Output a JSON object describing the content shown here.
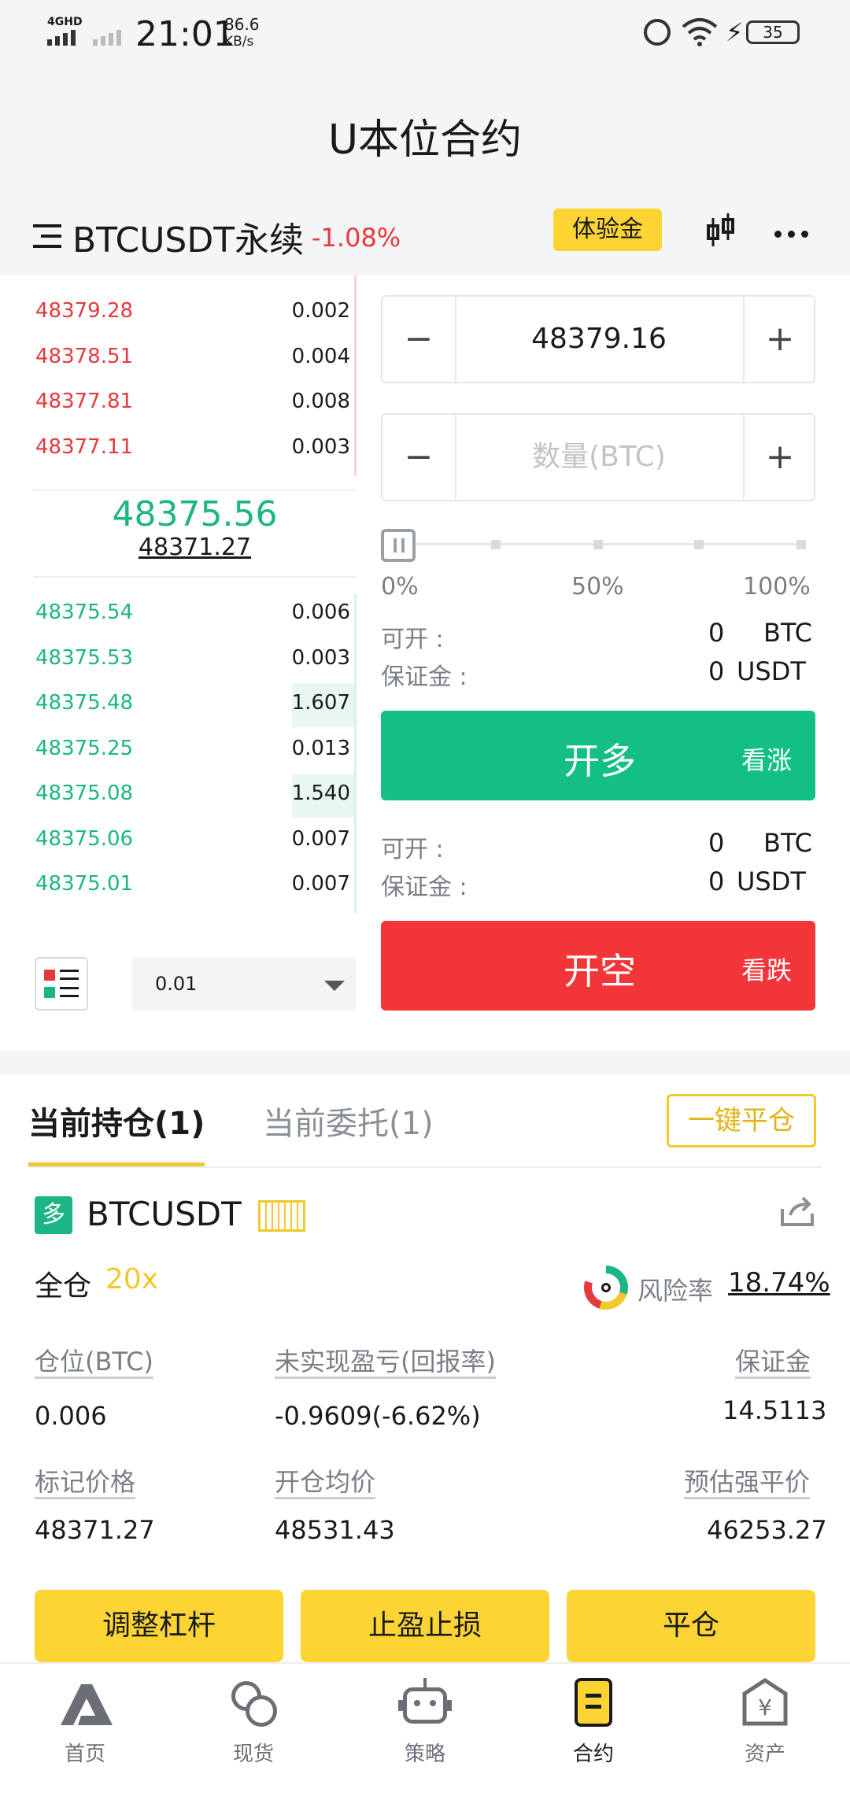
{
  "status": {
    "network": "4GHD",
    "time": "21:01",
    "speed_value": "86.6",
    "speed_unit": "KB/s",
    "battery": "35"
  },
  "page_title": "U本位合约",
  "instrument": {
    "name": "BTCUSDT永续",
    "change": "-1.08%",
    "badge": "体验金"
  },
  "orderbook": {
    "asks": [
      {
        "price": "48379.28",
        "qty": "0.002"
      },
      {
        "price": "48378.51",
        "qty": "0.004"
      },
      {
        "price": "48377.81",
        "qty": "0.008"
      },
      {
        "price": "48377.11",
        "qty": "0.003"
      }
    ],
    "last_price": "48375.56",
    "mark_price": "48371.27",
    "bids": [
      {
        "price": "48375.54",
        "qty": "0.006"
      },
      {
        "price": "48375.53",
        "qty": "0.003"
      },
      {
        "price": "48375.48",
        "qty": "1.607"
      },
      {
        "price": "48375.25",
        "qty": "0.013"
      },
      {
        "price": "48375.08",
        "qty": "1.540"
      },
      {
        "price": "48375.06",
        "qty": "0.007"
      },
      {
        "price": "48375.01",
        "qty": "0.007"
      }
    ],
    "depth_value": "0.01"
  },
  "order": {
    "price_value": "48379.16",
    "qty_placeholder": "数量(BTC)",
    "minus": "−",
    "plus": "+",
    "pct_0": "0%",
    "pct_50": "50%",
    "pct_100": "100%",
    "open_label": "可开 :",
    "margin_label": "保证金 :",
    "long_open_value": "0",
    "long_open_unit": "BTC",
    "long_margin_value": "0",
    "long_margin_unit": "USDT",
    "long_button": "开多",
    "long_sub": "看涨",
    "short_open_value": "0",
    "short_open_unit": "BTC",
    "short_margin_value": "0",
    "short_margin_unit": "USDT",
    "short_button": "开空",
    "short_sub": "看跌",
    "long_color": "#14bf85",
    "short_color": "#f23538"
  },
  "positions": {
    "tab_current": "当前持仓(1)",
    "tab_orders": "当前委托(1)",
    "close_all": "一键平仓",
    "side_tag": "多",
    "symbol": "BTCUSDT",
    "mode": "全仓",
    "leverage": "20x",
    "risk_label": "风险率",
    "risk_value": "18.74%",
    "f_size_label": "仓位(BTC)",
    "f_size_value": "0.006",
    "f_pnl_label": "未实现盈亏(回报率)",
    "f_pnl_value": "-0.9609(-6.62%)",
    "f_margin_label": "保证金",
    "f_margin_value": "14.5113",
    "f_mark_label": "标记价格",
    "f_mark_value": "48371.27",
    "f_entry_label": "开仓均价",
    "f_entry_value": "48531.43",
    "f_liq_label": "预估强平价",
    "f_liq_value": "46253.27",
    "btn_leverage": "调整杠杆",
    "btn_tpsl": "止盈止损",
    "btn_close": "平仓"
  },
  "nav": [
    {
      "label": "首页",
      "icon": "home-logo-icon"
    },
    {
      "label": "现货",
      "icon": "spot-coins-icon"
    },
    {
      "label": "策略",
      "icon": "robot-icon"
    },
    {
      "label": "合约",
      "icon": "contract-icon"
    },
    {
      "label": "资产",
      "icon": "wallet-icon"
    }
  ]
}
